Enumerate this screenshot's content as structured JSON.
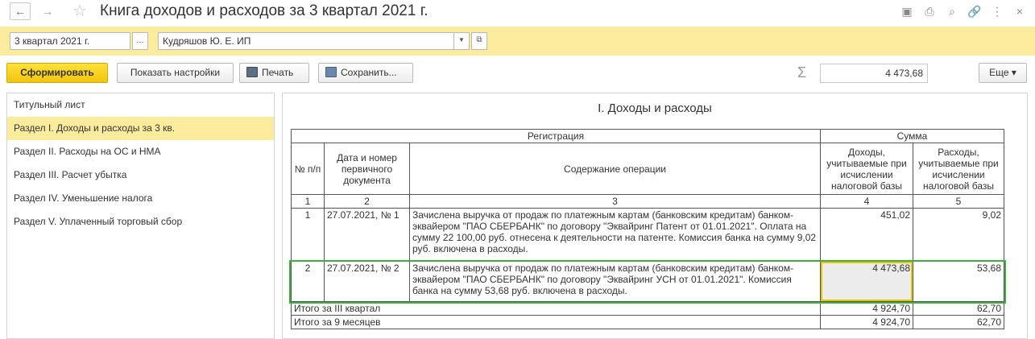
{
  "window": {
    "title": "Книга доходов и расходов за 3 квартал 2021 г.",
    "nav_back": "←",
    "nav_fwd": "→",
    "star": "☆",
    "icons": [
      "save-icon",
      "print-icon",
      "preview-icon",
      "link-icon",
      "more-icon",
      "close-icon"
    ],
    "icon_glyphs": [
      "▣",
      "⎙",
      "⌕",
      "🔗",
      "⋮",
      "×"
    ]
  },
  "params": {
    "period_value": "3 квартал 2021 г.",
    "period_btn": "...",
    "org_value": "Кудряшов Ю. Е. ИП",
    "org_dd": "▼",
    "org_open": "⧉"
  },
  "toolbar": {
    "generate": "Сформировать",
    "settings": "Показать настройки",
    "print": "Печать",
    "save": "Сохранить...",
    "sigma": "Σ",
    "sum_value": "4 473,68",
    "more": "Еще ▾"
  },
  "sidebar": {
    "items": [
      {
        "label": "Титульный лист",
        "active": false
      },
      {
        "label": "Раздел I. Доходы и расходы за 3 кв.",
        "active": true
      },
      {
        "label": "Раздел II. Расходы на ОС и НМА",
        "active": false
      },
      {
        "label": "Раздел III. Расчет убытка",
        "active": false
      },
      {
        "label": "Раздел IV. Уменьшение налога",
        "active": false
      },
      {
        "label": "Раздел V. Уплаченный торговый сбор",
        "active": false
      }
    ]
  },
  "report": {
    "title": "I. Доходы и расходы",
    "header": {
      "registration": "Регистрация",
      "sum": "Сумма",
      "num": "№ п/п",
      "date": "Дата и номер первичного документа",
      "content": "Содержание операции",
      "income": "Доходы, учитываемые при исчислении налоговой базы",
      "expense": "Расходы, учитываемые при исчислении налоговой базы",
      "col_nums": [
        "1",
        "2",
        "3",
        "4",
        "5"
      ]
    },
    "rows": [
      {
        "num": "1",
        "date": "27.07.2021, № 1",
        "content": "Зачислена выручка от продаж по платежным картам (банковским кредитам) банком-эквайером \"ПАО СБЕРБАНК\" по договору \"Эквайринг Патент от 01.01.2021\". Оплата на сумму 22 100,00 руб. отнесена к деятельности на патенте. Комиссия банка на сумму 9,02 руб. включена в расходы.",
        "income": "451,02",
        "expense": "9,02"
      },
      {
        "num": "2",
        "date": "27.07.2021, № 2",
        "content": "Зачислена выручка от продаж по платежным картам (банковским кредитам) банком-эквайером \"ПАО СБЕРБАНК\" по договору \"Эквайринг УСН от 01.01.2021\". Комиссия банка на сумму 53,68 руб. включена в расходы.",
        "income": "4 473,68",
        "expense": "53,68"
      }
    ],
    "totals": [
      {
        "label": "Итого за III квартал",
        "income": "4 924,70",
        "expense": "62,70"
      },
      {
        "label": "Итого за 9 месяцев",
        "income": "4 924,70",
        "expense": "62,70"
      }
    ]
  }
}
